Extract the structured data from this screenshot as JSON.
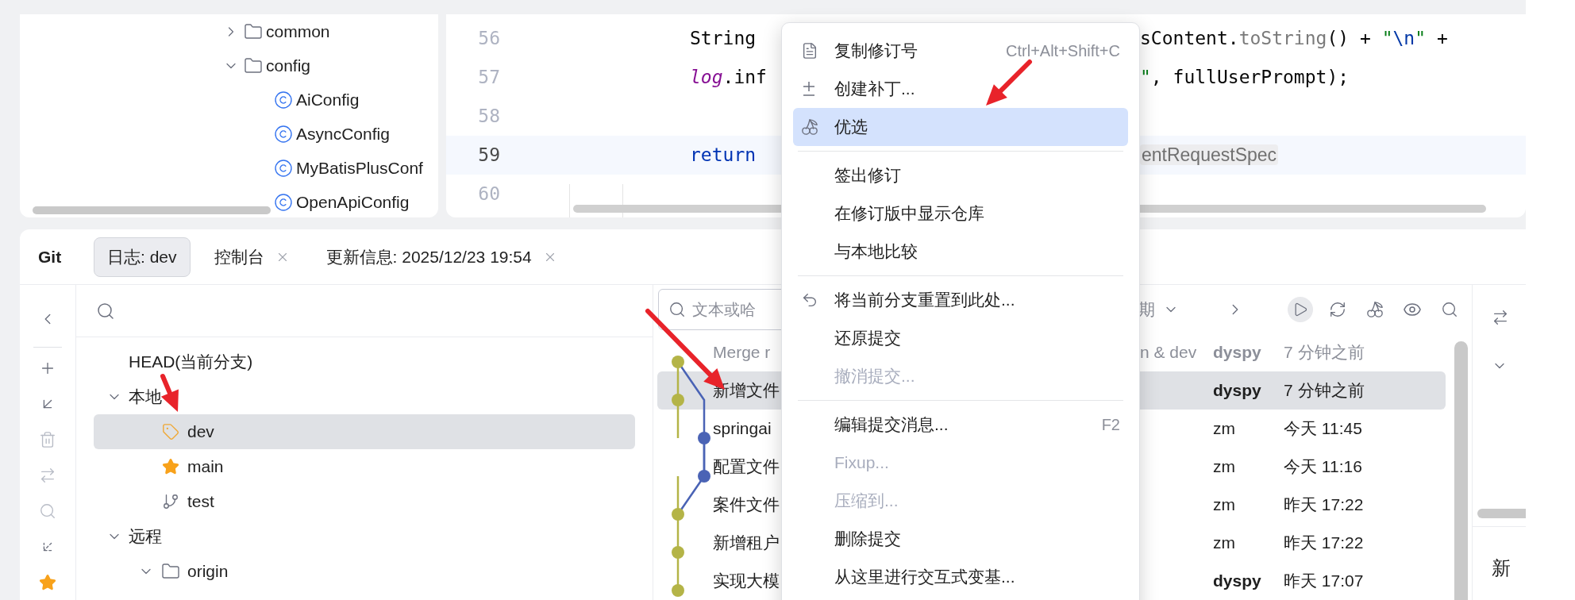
{
  "project_tree": {
    "items": [
      {
        "label": "common",
        "kind": "package",
        "expanded": false
      },
      {
        "label": "config",
        "kind": "package",
        "expanded": true,
        "children": [
          {
            "label": "AiConfig",
            "kind": "class"
          },
          {
            "label": "AsyncConfig",
            "kind": "class"
          },
          {
            "label": "MyBatisPlusConf",
            "kind": "class"
          },
          {
            "label": "OpenApiConfig",
            "kind": "class"
          }
        ]
      }
    ]
  },
  "editor": {
    "lines": [
      {
        "number": "56",
        "current": false,
        "left": [
          {
            "kind": "plain",
            "text": "String"
          }
        ],
        "right": [
          {
            "kind": "plain",
            "text": "sContent."
          },
          {
            "kind": "method",
            "text": "toString"
          },
          {
            "kind": "plain",
            "text": "() + "
          },
          {
            "kind": "string",
            "text": "\""
          },
          {
            "kind": "escape",
            "text": "\\n"
          },
          {
            "kind": "string",
            "text": "\""
          },
          {
            "kind": "plain",
            "text": " +"
          }
        ]
      },
      {
        "number": "57",
        "current": false,
        "left": [
          {
            "kind": "field",
            "text": "log"
          },
          {
            "kind": "plain",
            "text": ".inf"
          }
        ],
        "right": [
          {
            "kind": "string",
            "text": "\""
          },
          {
            "kind": "plain",
            "text": ", fullUserPrompt);"
          }
        ]
      },
      {
        "number": "58",
        "current": false
      },
      {
        "number": "59",
        "current": true,
        "left": [
          {
            "kind": "keyword",
            "text": "return"
          }
        ],
        "right": [
          {
            "kind": "hint",
            "text": "entRequestSpec"
          }
        ]
      },
      {
        "number": "60",
        "current": false
      }
    ]
  },
  "git": {
    "title": "Git",
    "tabs": [
      {
        "label": "日志: dev",
        "selected": true,
        "closable": false
      },
      {
        "label": "控制台",
        "selected": false,
        "closable": true
      },
      {
        "label": "更新信息: 2025/12/23 19:54",
        "selected": false,
        "closable": true
      }
    ],
    "tools": [
      {
        "kind": "collapse",
        "disabled": false
      },
      {
        "kind": "add",
        "disabled": false
      },
      {
        "kind": "checkout",
        "disabled": false
      },
      {
        "kind": "delete",
        "disabled": true
      },
      {
        "kind": "compare",
        "disabled": true
      },
      {
        "kind": "search",
        "disabled": true
      },
      {
        "kind": "fetch",
        "disabled": false
      },
      {
        "kind": "favorite",
        "disabled": false
      }
    ],
    "branches": {
      "tree": [
        {
          "label": "HEAD(当前分支)",
          "kind": "head",
          "selected": false
        },
        {
          "label": "本地",
          "kind": "group",
          "expanded": true,
          "selected": false,
          "children": [
            {
              "label": "dev",
              "kind": "current",
              "selected": true
            },
            {
              "label": "main",
              "kind": "favorite",
              "selected": false
            },
            {
              "label": "test",
              "kind": "branch",
              "selected": false
            }
          ]
        },
        {
          "label": "远程",
          "kind": "group",
          "expanded": true,
          "selected": false,
          "children": [
            {
              "label": "origin",
              "kind": "remote",
              "expanded": true,
              "selected": false
            }
          ]
        }
      ]
    },
    "log": {
      "filter": {
        "placeholder": "文本或哈"
      },
      "sort_label": "期",
      "toolbar": [
        {
          "kind": "next",
          "on": false
        },
        {
          "kind": "play",
          "on": true
        },
        {
          "kind": "refresh",
          "on": false
        },
        {
          "kind": "cherry",
          "on": false
        },
        {
          "kind": "eye",
          "on": false
        },
        {
          "kind": "search",
          "on": false
        }
      ],
      "commits": [
        {
          "message": "Merge r",
          "refs": "n & dev",
          "author": "dyspy",
          "time": "7 分钟之前",
          "kind": "main",
          "color": "#b4b447",
          "selected": false,
          "dimmed": true,
          "own": true
        },
        {
          "message": "新增文件",
          "author": "dyspy",
          "time": "7 分钟之前",
          "kind": "main",
          "color": "#b4b447",
          "selected": true,
          "dimmed": false,
          "own": true
        },
        {
          "message": "springai",
          "author": "zm",
          "time": "今天 11:45",
          "kind": "side",
          "color": "#4a63b5",
          "selected": false,
          "dimmed": false,
          "own": false
        },
        {
          "message": "配置文件",
          "author": "zm",
          "time": "今天 11:16",
          "kind": "side",
          "color": "#4a63b5",
          "selected": false,
          "dimmed": false,
          "own": false
        },
        {
          "message": "案件文件",
          "author": "zm",
          "time": "昨天 17:22",
          "kind": "main",
          "color": "#b4b447",
          "selected": false,
          "dimmed": false,
          "own": false
        },
        {
          "message": "新增租户",
          "author": "zm",
          "time": "昨天 17:22",
          "kind": "main",
          "color": "#b4b447",
          "selected": false,
          "dimmed": false,
          "own": false
        },
        {
          "message": "实现大模",
          "author": "dyspy",
          "time": "昨天 17:07",
          "kind": "main",
          "color": "#b4b447",
          "selected": false,
          "dimmed": false,
          "own": true
        }
      ]
    },
    "details": {
      "text": "新"
    }
  },
  "context_menu": {
    "items": [
      {
        "kind": "copy",
        "label": "复制修订号",
        "shortcut": "Ctrl+Alt+Shift+C",
        "disabled": false,
        "selected": false
      },
      {
        "kind": "patch",
        "label": "创建补丁...",
        "disabled": false,
        "selected": false
      },
      {
        "kind": "cherry",
        "label": "优选",
        "disabled": false,
        "selected": true
      },
      {
        "kind": "separator"
      },
      {
        "kind": "plain",
        "label": "签出修订",
        "disabled": false,
        "selected": false
      },
      {
        "kind": "plain",
        "label": "在修订版中显示仓库",
        "disabled": false,
        "selected": false
      },
      {
        "kind": "plain",
        "label": "与本地比较",
        "disabled": false,
        "selected": false
      },
      {
        "kind": "separator"
      },
      {
        "kind": "reset",
        "label": "将当前分支重置到此处...",
        "disabled": false,
        "selected": false
      },
      {
        "kind": "plain",
        "label": "还原提交",
        "disabled": false,
        "selected": false
      },
      {
        "kind": "plain",
        "label": "撤消提交...",
        "disabled": true,
        "selected": false
      },
      {
        "kind": "separator"
      },
      {
        "kind": "plain",
        "label": "编辑提交消息...",
        "shortcut": "F2",
        "disabled": false,
        "selected": false
      },
      {
        "kind": "plain",
        "label": "Fixup...",
        "disabled": true,
        "selected": false
      },
      {
        "kind": "plain",
        "label": "压缩到...",
        "disabled": true,
        "selected": false
      },
      {
        "kind": "plain",
        "label": "删除提交",
        "disabled": false,
        "selected": false
      },
      {
        "kind": "plain",
        "label": "从这里进行交互式变基...",
        "disabled": false,
        "selected": false
      }
    ]
  }
}
